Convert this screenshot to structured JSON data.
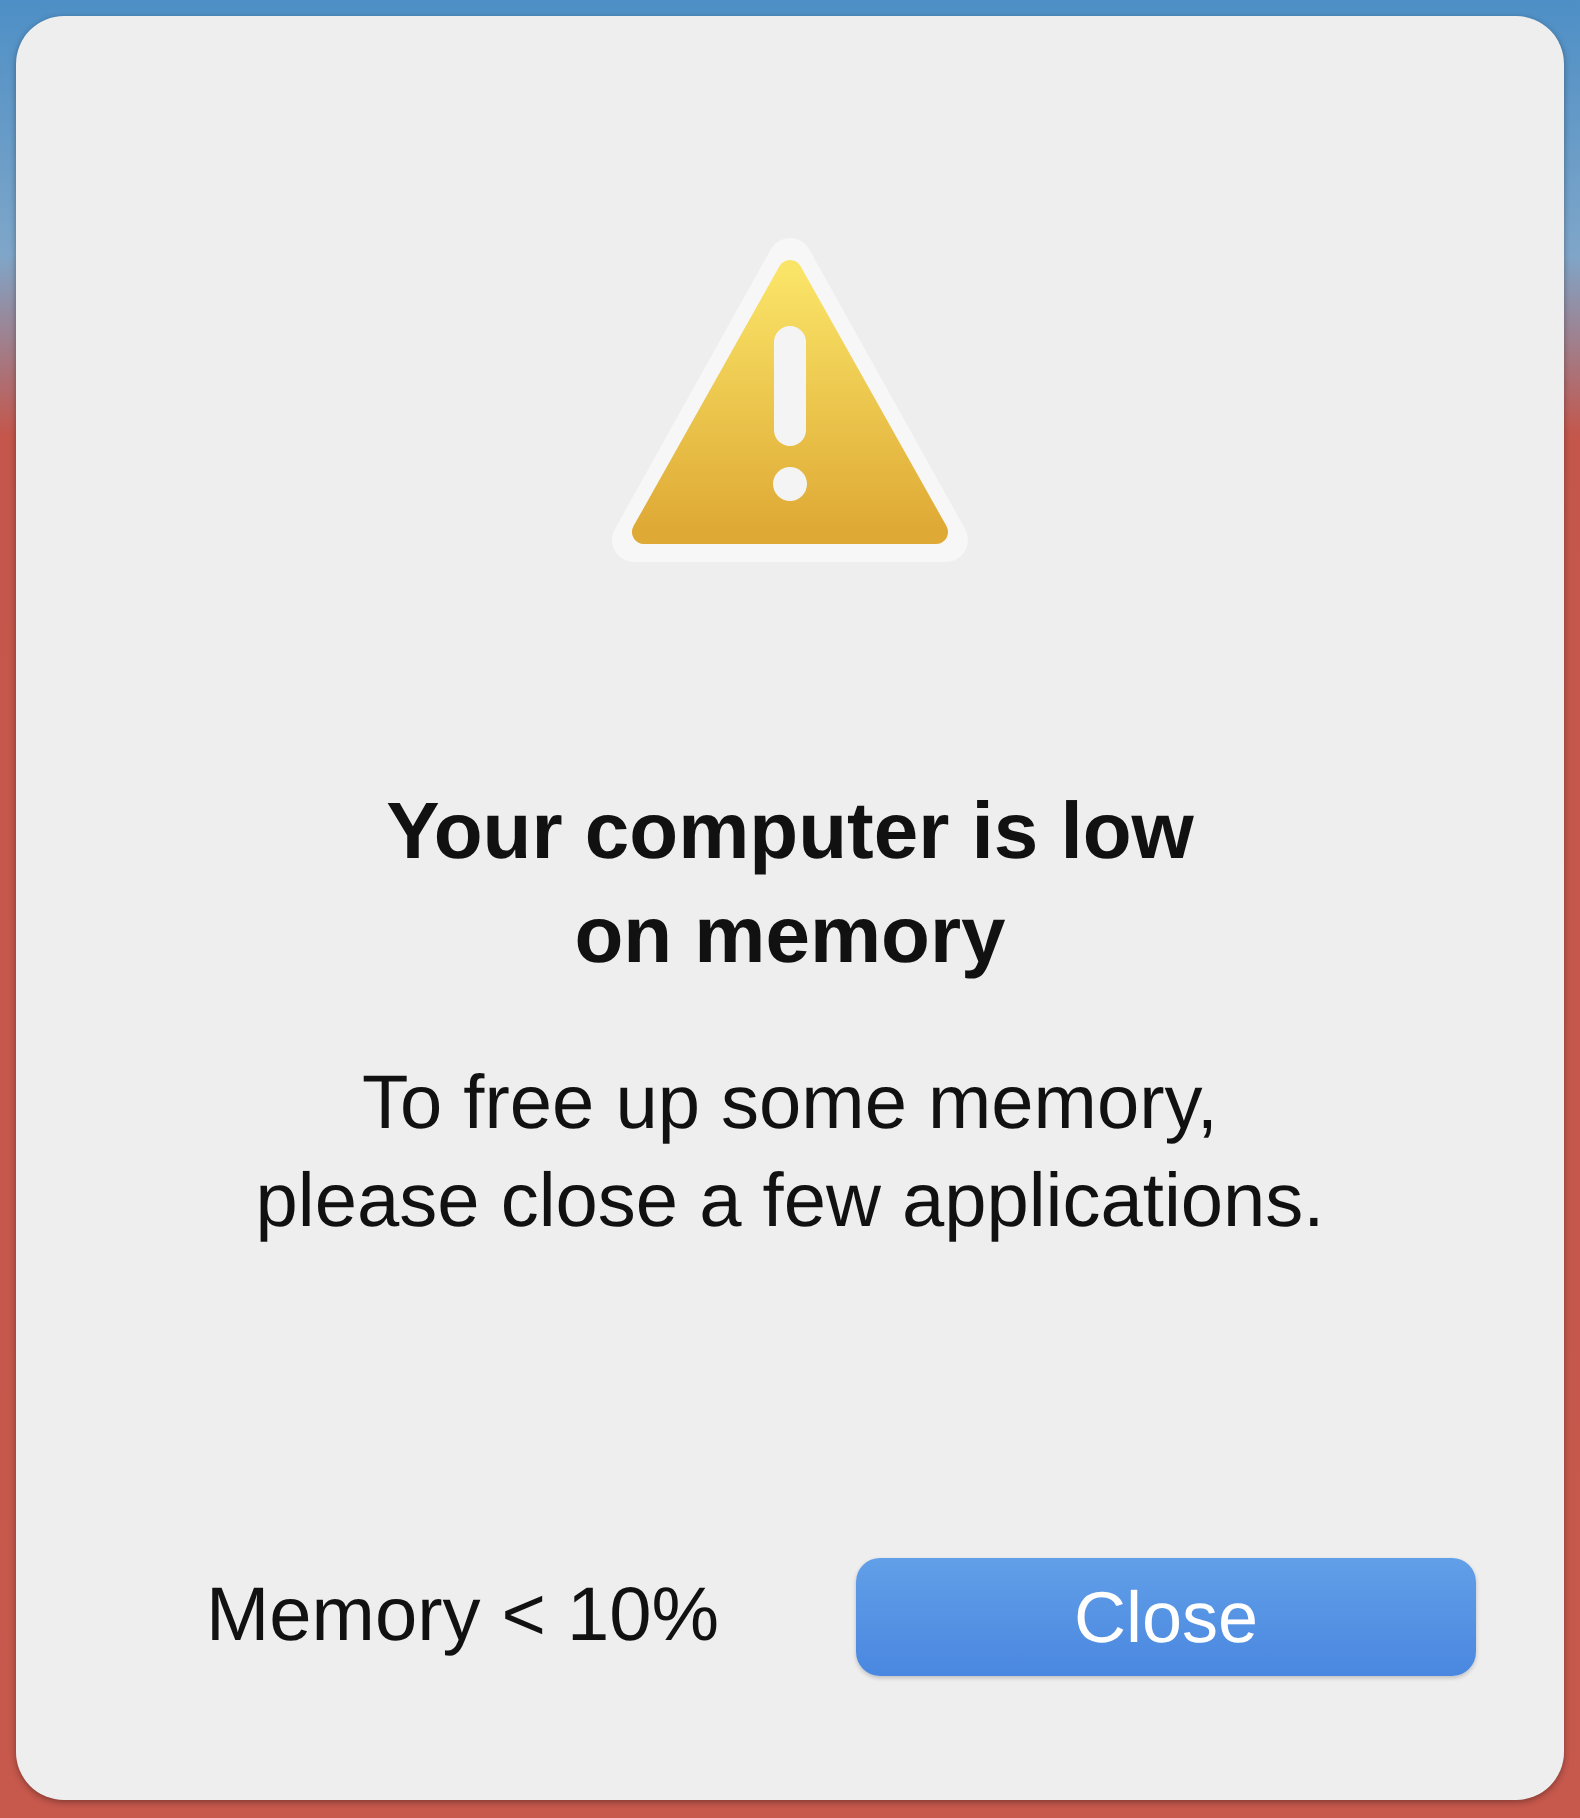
{
  "dialog": {
    "title": "Your computer is low\non memory",
    "message": "To free up some memory,\nplease close a few applications."
  },
  "footer": {
    "status": "Memory < 10%",
    "buttons": [
      {
        "label": "Close",
        "default": true
      }
    ]
  }
}
